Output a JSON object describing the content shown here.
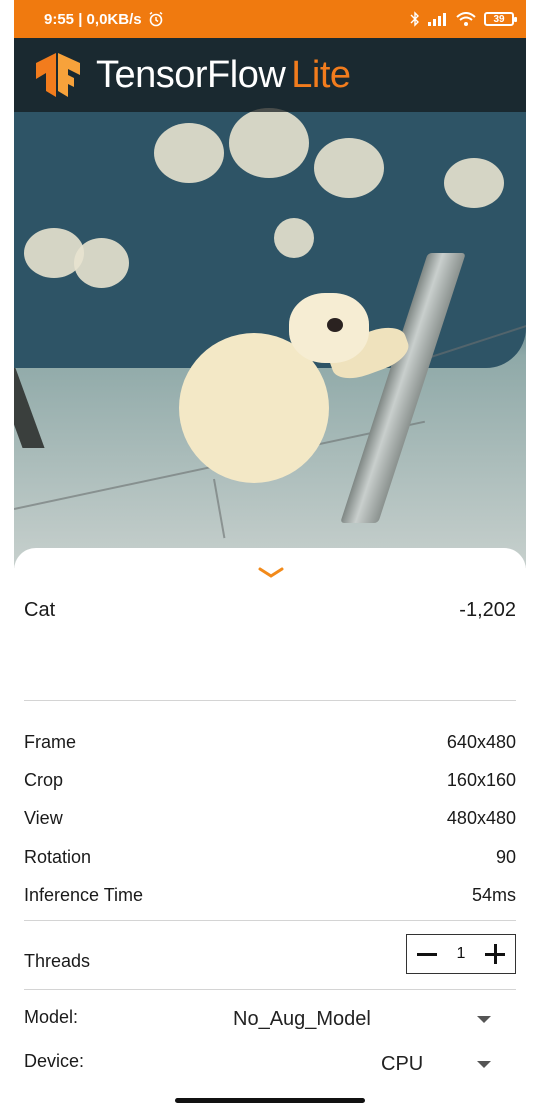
{
  "status_bar": {
    "time_speed": "9:55 | 0,0KB/s",
    "battery": "39",
    "bg_color": "#f07a0f"
  },
  "header": {
    "logo_main": "TensorFlow",
    "logo_accent": "Lite",
    "accent_color": "#f27c1d"
  },
  "result": {
    "label": "Cat",
    "score": "-1,202"
  },
  "stats": [
    {
      "label": "Frame",
      "value": "640x480"
    },
    {
      "label": "Crop",
      "value": "160x160"
    },
    {
      "label": "View",
      "value": "480x480"
    },
    {
      "label": "Rotation",
      "value": "90"
    },
    {
      "label": "Inference Time",
      "value": "54ms"
    }
  ],
  "threads": {
    "label": "Threads",
    "value": "1"
  },
  "model": {
    "label": "Model:",
    "value": "No_Aug_Model"
  },
  "device": {
    "label": "Device:",
    "value": "CPU"
  },
  "icons": [
    "alarm-icon",
    "bluetooth-icon",
    "signal-icon",
    "wifi-icon",
    "battery-icon",
    "chevron-down-icon",
    "minus-icon",
    "plus-icon",
    "dropdown-caret-icon"
  ]
}
